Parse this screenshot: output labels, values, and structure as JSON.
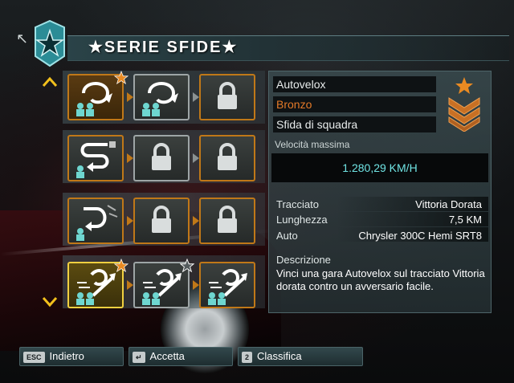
{
  "header": {
    "title": "★SERIE SFIDE★"
  },
  "grid": {
    "rows": [
      {
        "tiles": [
          "Circuito (completato, stella oro)",
          "Circuito",
          "Bloccato"
        ]
      },
      {
        "tiles": [
          "Sprint",
          "Bloccato",
          "Bloccato"
        ]
      },
      {
        "tiles": [
          "Drift",
          "Bloccato",
          "Bloccato"
        ]
      },
      {
        "tiles": [
          "Autovelox (selezionato, stella oro)",
          "Autovelox (stella argento)",
          "Autovelox"
        ]
      }
    ]
  },
  "event": {
    "name": "Autovelox",
    "tier": "Bronzo",
    "type": "Sfida di squadra",
    "speed_label": "Velocità massima",
    "speed_value": "1.280,29 KM/H"
  },
  "stats": [
    {
      "label": "Tracciato",
      "value": "Vittoria Dorata"
    },
    {
      "label": "Lunghezza",
      "value": "7,5 KM"
    },
    {
      "label": "Auto",
      "value": "Chrysler 300C Hemi SRT8"
    }
  ],
  "description": {
    "label": "Descrizione",
    "text": "Vinci una gara Autovelox sul tracciato Vittoria dorata contro un avversario facile."
  },
  "footer": {
    "buttons": [
      {
        "key": "ESC",
        "label": "Indietro"
      },
      {
        "key": "↵",
        "label": "Accetta"
      },
      {
        "key": "2",
        "label": "Classifica"
      }
    ]
  },
  "colors": {
    "accent_orange": "#e47a28",
    "frame_orange": "#c07818",
    "speed_cyan": "#6fe3e3",
    "select_yellow": "#f0d040"
  }
}
